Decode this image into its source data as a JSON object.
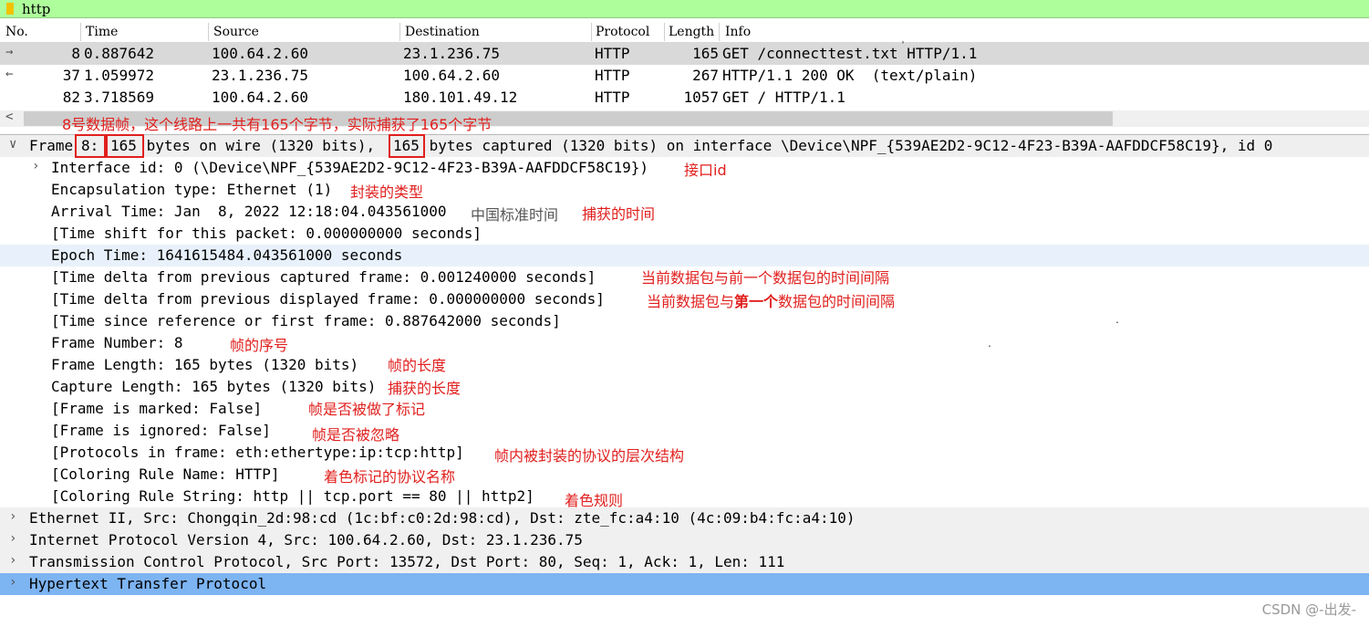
{
  "filter": {
    "value": "http"
  },
  "packet_list": {
    "columns": [
      "No.",
      "Time",
      "Source",
      "Destination",
      "Protocol",
      "Length",
      "Info"
    ],
    "rows": [
      {
        "no": "8",
        "time": "0.887642",
        "src": "100.64.2.60",
        "dst": "23.1.236.75",
        "proto": "HTTP",
        "len": "165",
        "info": "GET /connecttest.txt HTTP/1.1",
        "selected": true
      },
      {
        "no": "37",
        "time": "1.059972",
        "src": "23.1.236.75",
        "dst": "100.64.2.60",
        "proto": "HTTP",
        "len": "267",
        "info": "HTTP/1.1 200 OK  (text/plain)",
        "selected": false
      },
      {
        "no": "82",
        "time": "3.718569",
        "src": "100.64.2.60",
        "dst": "180.101.49.12",
        "proto": "HTTP",
        "len": "1057",
        "info": "GET / HTTP/1.1",
        "selected": false
      }
    ]
  },
  "details": {
    "frame_prefix": "Frame ",
    "frame_num": "8:",
    "frame_len1": "165",
    "frame_mid": " bytes on wire (1320 bits), ",
    "frame_len2": "165",
    "frame_rest": " bytes captured (1320 bits) on interface \\Device\\NPF_{539AE2D2-9C12-4F23-B39A-AAFDDCF58C19}, id 0",
    "interface_id": "Interface id: 0 (\\Device\\NPF_{539AE2D2-9C12-4F23-B39A-AAFDDCF58C19})",
    "encapsulation": "Encapsulation type: Ethernet (1)",
    "arrival": "Arrival Time: Jan  8, 2022 12:18:04.043561000",
    "arrival_tz": "中国标准时间",
    "time_shift": "[Time shift for this packet: 0.000000000 seconds]",
    "epoch": "Epoch Time: 1641615484.043561000 seconds",
    "delta_captured": "[Time delta from previous captured frame: 0.001240000 seconds]",
    "delta_displayed": "[Time delta from previous displayed frame: 0.000000000 seconds]",
    "since_ref": "[Time since reference or first frame: 0.887642000 seconds]",
    "frame_number": "Frame Number: 8",
    "frame_length": "Frame Length: 165 bytes (1320 bits)",
    "capture_length": "Capture Length: 165 bytes (1320 bits)",
    "marked": "[Frame is marked: False]",
    "ignored": "[Frame is ignored: False]",
    "protocols": "[Protocols in frame: eth:ethertype:ip:tcp:http]",
    "coloring_name": "[Coloring Rule Name: HTTP]",
    "coloring_string": "[Coloring Rule String: http || tcp.port == 80 || http2]",
    "ethernet": "Ethernet II, Src: Chongqin_2d:98:cd (1c:bf:c0:2d:98:cd), Dst: zte_fc:a4:10 (4c:09:b4:fc:a4:10)",
    "ip": "Internet Protocol Version 4, Src: 100.64.2.60, Dst: 23.1.236.75",
    "tcp": "Transmission Control Protocol, Src Port: 13572, Dst Port: 80, Seq: 1, Ack: 1, Len: 111",
    "http": "Hypertext Transfer Protocol"
  },
  "annotations": {
    "frame_summary": "8号数据帧，这个线路上一共有165个字节，实际捕获了165个字节",
    "interface": "接口id",
    "encapsulation": "封装的类型",
    "arrival": "捕获的时间",
    "delta_captured": "当前数据包与前一个数据包的时间间隔",
    "delta_displayed_a": "当前数据包与",
    "delta_displayed_b": "第一个",
    "delta_displayed_c": "数据包的时间间隔",
    "frame_number": "帧的序号",
    "frame_length": "帧的长度",
    "capture_length": "捕获的长度",
    "marked": "帧是否被做了标记",
    "ignored": "帧是否被忽略",
    "protocols": "帧内被封装的协议的层次结构",
    "coloring_name": "着色标记的协议名称",
    "coloring_string": "着色规则"
  },
  "watermark": "CSDN @-出发-",
  "colors": {
    "filter_bg": "#aeff9b",
    "selected_row": "#d9d9d9",
    "epoch_highlight": "#e8f1fb",
    "http_highlight": "#7db4f2",
    "annotation": "#e0201e"
  }
}
